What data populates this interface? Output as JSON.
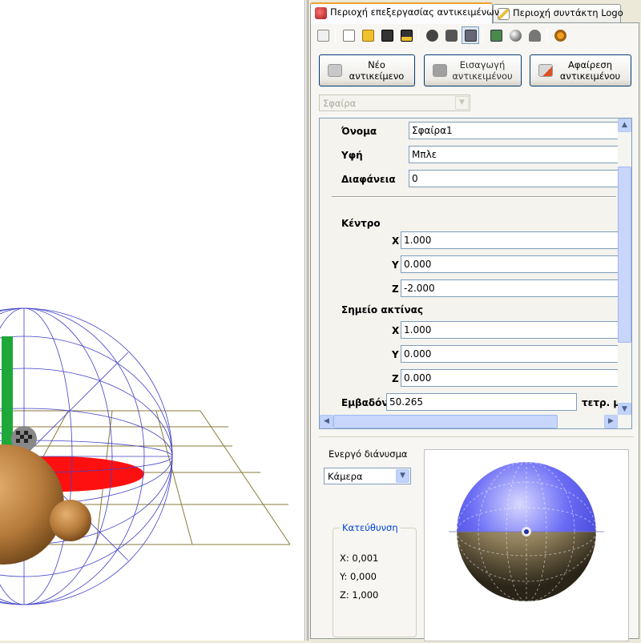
{
  "tabs": [
    {
      "label": "Περιοχή επεξεργασίας αντικειμένων",
      "active": true,
      "icon": "objects-icon"
    },
    {
      "label": "Περιοχή συντάκτη Logo",
      "active": false,
      "icon": "logo-editor-icon"
    }
  ],
  "toolbar": {
    "icons": [
      "erase-icon",
      "new-file-icon",
      "open-folder-icon",
      "save-icon",
      "save-as-icon",
      "move-icon",
      "camera-view-icon",
      "view-mode-icon",
      "export-icon",
      "shading-icon",
      "render-icon",
      "settings-icon"
    ]
  },
  "buttons": {
    "new_object": "Νέο\nαντικείμενο",
    "insert_object": "Εισαγωγή\nαντικειμένου",
    "remove_object": "Αφαίρεση\nαντικειμένου"
  },
  "object_type": "Σφαίρα",
  "properties": {
    "name_label": "Όνομα",
    "name_value": "Σφαίρα1",
    "texture_label": "Υφή",
    "texture_value": "Μπλε",
    "transparency_label": "Διαφάνεια",
    "transparency_value": "0",
    "center_label": "Κέντρο",
    "center": {
      "x_label": "X",
      "x": "1.000",
      "y_label": "Y",
      "y": "0.000",
      "z_label": "Z",
      "z": "-2.000"
    },
    "radius_point_label": "Σημείο ακτίνας",
    "radius_point": {
      "x_label": "X",
      "x": "1.000",
      "y_label": "Y",
      "y": "0.000",
      "z_label": "Z",
      "z": "0.000"
    },
    "area_label": "Εμβαδόν",
    "area_value": "50.265",
    "area_unit": "τετρ. μ"
  },
  "lower": {
    "active_vector_label": "Ενεργό διάνυσμα",
    "active_vector_value": "Κάμερα",
    "direction_group_label": "Κατεύθυνση",
    "direction": {
      "x": "X: 0,001",
      "y": "Y: 0,000",
      "z": "Z: 1,000"
    }
  },
  "colors": {
    "sphere_top": "#5a5cf0",
    "sphere_bottom": "#8a7a55",
    "accent_tab": "#f0a030"
  }
}
